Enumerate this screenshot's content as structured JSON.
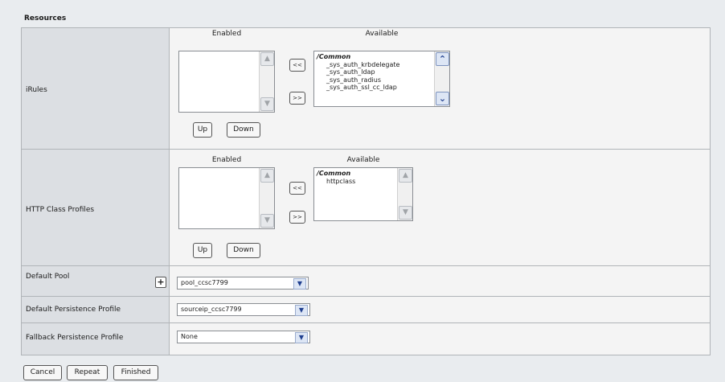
{
  "section_title": "Resources",
  "irules": {
    "label": "iRules",
    "enabled_label": "Enabled",
    "available_label": "Available",
    "available_group": "/Common",
    "available_items": [
      "_sys_auth_krbdelegate",
      "_sys_auth_ldap",
      "_sys_auth_radius",
      "_sys_auth_ssl_cc_ldap"
    ],
    "move_left": "<<",
    "move_right": ">>",
    "up": "Up",
    "down": "Down"
  },
  "http_class": {
    "label": "HTTP Class Profiles",
    "enabled_label": "Enabled",
    "available_label": "Available",
    "available_group": "/Common",
    "available_items": [
      "httpclass"
    ],
    "move_left": "<<",
    "move_right": ">>",
    "up": "Up",
    "down": "Down"
  },
  "default_pool": {
    "label": "Default Pool",
    "add": "+",
    "value": "pool_ccsc7799"
  },
  "default_persistence": {
    "label": "Default Persistence Profile",
    "value": "sourceip_ccsc7799"
  },
  "fallback_persistence": {
    "label": "Fallback Persistence Profile",
    "value": "None"
  },
  "actions": {
    "cancel": "Cancel",
    "repeat": "Repeat",
    "finished": "Finished"
  }
}
